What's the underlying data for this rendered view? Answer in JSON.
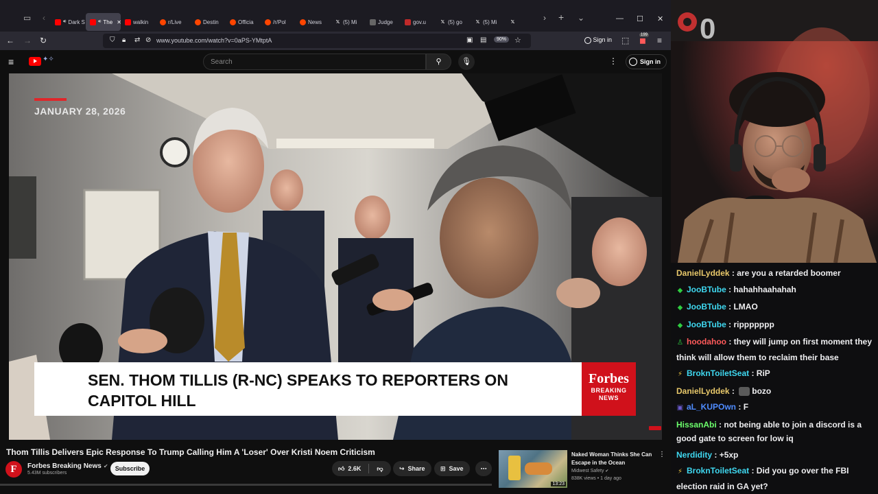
{
  "browser": {
    "tabs": [
      {
        "label": "Dark S",
        "favicon": "youtube",
        "audio": true
      },
      {
        "label": "The",
        "favicon": "youtube",
        "audio": true,
        "active": true
      },
      {
        "label": "walkin",
        "favicon": "youtube"
      },
      {
        "label": "r/Live",
        "favicon": "reddit"
      },
      {
        "label": "Destin",
        "favicon": "reddit"
      },
      {
        "label": "Officia",
        "favicon": "reddit"
      },
      {
        "label": "/r/Pol",
        "favicon": "reddit"
      },
      {
        "label": "News",
        "favicon": "reddit"
      },
      {
        "label": "(5) Mi",
        "favicon": "x"
      },
      {
        "label": "Judge",
        "favicon": "dark"
      },
      {
        "label": "gov.u",
        "favicon": "gov"
      },
      {
        "label": "(5) go",
        "favicon": "x"
      },
      {
        "label": "(5) Mi",
        "favicon": "x"
      },
      {
        "label": "",
        "favicon": "x"
      }
    ],
    "url": "www.youtube.com/watch?v=0aPS-YMtptA",
    "zoom": "90%",
    "signin_label": "Sign in",
    "notif_count": "199"
  },
  "youtube": {
    "search_placeholder": "Search",
    "signin_label": "Sign in"
  },
  "video": {
    "date_caption": "JANUARY 28, 2026",
    "lower_third": "SEN. THOM TILLIS (R-NC) SPEAKS TO REPORTERS ON CAPITOL HILL",
    "forbes_logo": "Forbes",
    "forbes_sub_1": "BREAKING",
    "forbes_sub_2": "NEWS",
    "title": "Thom Tillis Delivers Epic Response To Trump Calling Him A 'Loser' Over Kristi Noem Criticism",
    "channel": "Forbes Breaking News",
    "subscribers": "5.43M subscribers",
    "subscribe_label": "Subscribe",
    "likes": "2.6K",
    "share_label": "Share",
    "save_label": "Save"
  },
  "recommendation": {
    "title": "Naked Woman Thinks She Can Escape in the Ocean",
    "channel": "Midwest Safety",
    "views": "838K views",
    "age": "1 day ago",
    "duration": "13:23"
  },
  "chat": [
    {
      "user": "DanielLyddek",
      "color": "#e8c86a",
      "badge": "",
      "message": "are you a retarded boomer"
    },
    {
      "user": "JooBTube",
      "color": "#3fd8f0",
      "badge": "◆",
      "badge_color": "#2ecc40",
      "message": "hahahhaahahah"
    },
    {
      "user": "JooBTube",
      "color": "#3fd8f0",
      "badge": "◆",
      "badge_color": "#2ecc40",
      "message": "LMAO"
    },
    {
      "user": "JooBTube",
      "color": "#3fd8f0",
      "badge": "◆",
      "badge_color": "#2ecc40",
      "message": "rippppppp"
    },
    {
      "user": "hoodahoo",
      "color": "#ff5a5a",
      "badge": "♙",
      "badge_color": "#2ecc40",
      "message": "they will jump on first moment they think will allow them to reclaim their base"
    },
    {
      "user": "BroknToiletSeat",
      "color": "#3fd8f0",
      "badge": "⚡",
      "badge_color": "#e8c040",
      "message": "RiP"
    },
    {
      "user": "DanielLyddek",
      "color": "#e8c86a",
      "badge": "",
      "message": "bozo",
      "emote": true
    },
    {
      "user": "aL_KUPOwn",
      "color": "#4f8cff",
      "badge": "▣",
      "badge_color": "#6a5acd",
      "message": "F"
    },
    {
      "user": "HissanAbi",
      "color": "#6cff6c",
      "badge": "",
      "message": "not being able to join a discord is a good gate to screen for low iq"
    },
    {
      "user": "Nerdidity",
      "color": "#3fd8f0",
      "badge": "",
      "message": "+5xp"
    },
    {
      "user": "BroknToiletSeat",
      "color": "#3fd8f0",
      "badge": "⚡",
      "badge_color": "#e8c040",
      "message": "Did you go over the FBI election raid in GA yet?"
    }
  ],
  "colors": {
    "youtube_red": "#ff0000",
    "forbes_red": "#d0111b",
    "browser_bg": "#1c1b22"
  }
}
